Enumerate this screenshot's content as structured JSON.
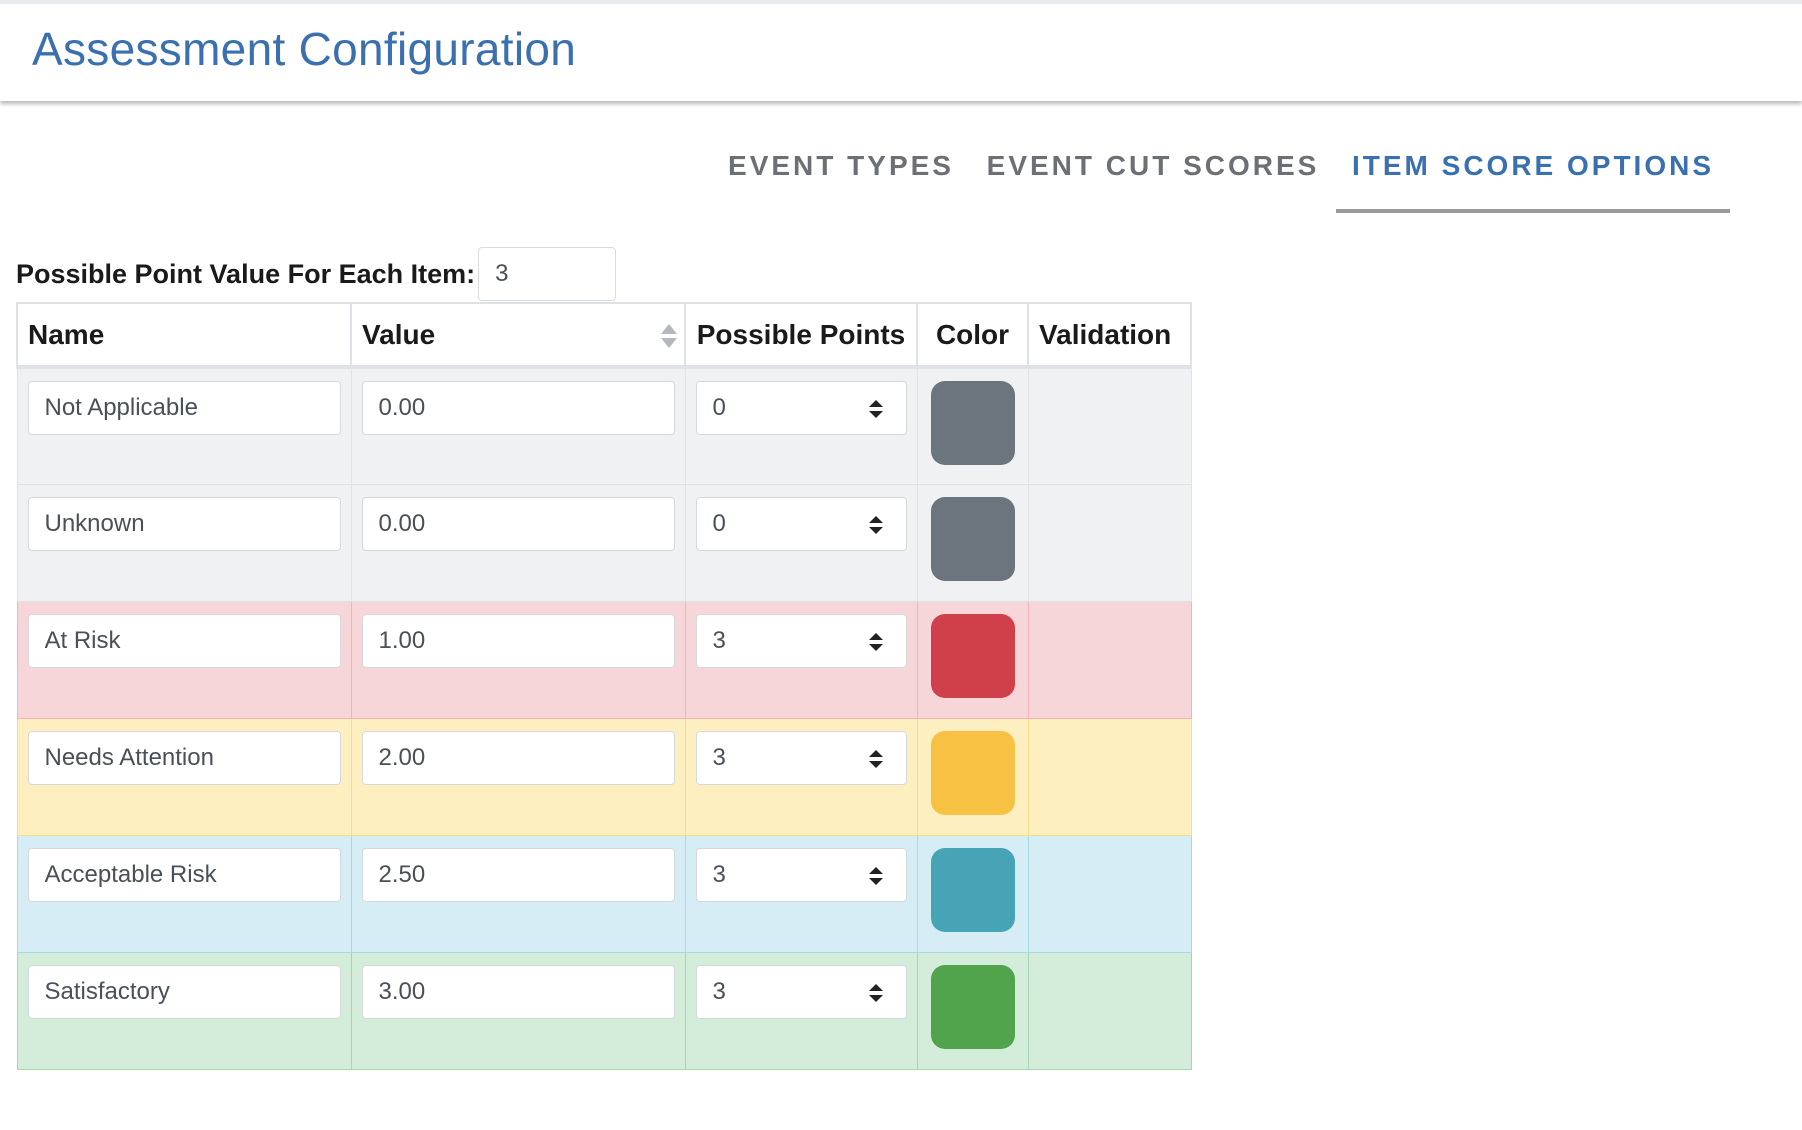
{
  "header": {
    "title": "Assessment Configuration"
  },
  "tabs": [
    {
      "label": "EVENT TYPES",
      "active": false
    },
    {
      "label": "EVENT CUT SCORES",
      "active": false
    },
    {
      "label": "ITEM SCORE OPTIONS",
      "active": true
    }
  ],
  "possible_point_value": {
    "label": "Possible Point Value For Each Item:",
    "value": "3"
  },
  "table": {
    "columns": [
      "Name",
      "Value",
      "Possible Points",
      "Color",
      "Validation"
    ],
    "rows": [
      {
        "name": "Not Applicable",
        "value": "0.00",
        "points": "0",
        "color": "#6c757d",
        "row_color": "#f0f1f3",
        "validation": ""
      },
      {
        "name": "Unknown",
        "value": "0.00",
        "points": "0",
        "color": "#6c757d",
        "row_color": "#f0f1f3",
        "validation": ""
      },
      {
        "name": "At Risk",
        "value": "1.00",
        "points": "3",
        "color": "#d0404a",
        "row_color": "#f7d6d9",
        "validation": ""
      },
      {
        "name": "Needs Attention",
        "value": "2.00",
        "points": "3",
        "color": "#f7c143",
        "row_color": "#fdefc0",
        "validation": ""
      },
      {
        "name": "Acceptable Risk",
        "value": "2.50",
        "points": "3",
        "color": "#47a3b6",
        "row_color": "#d6edf5",
        "validation": ""
      },
      {
        "name": "Satisfactory",
        "value": "3.00",
        "points": "3",
        "color": "#51a34c",
        "row_color": "#d4ecda",
        "validation": ""
      }
    ]
  },
  "icons": {
    "sort": "sort-icon",
    "select_arrow": "updown-arrow-icon"
  }
}
